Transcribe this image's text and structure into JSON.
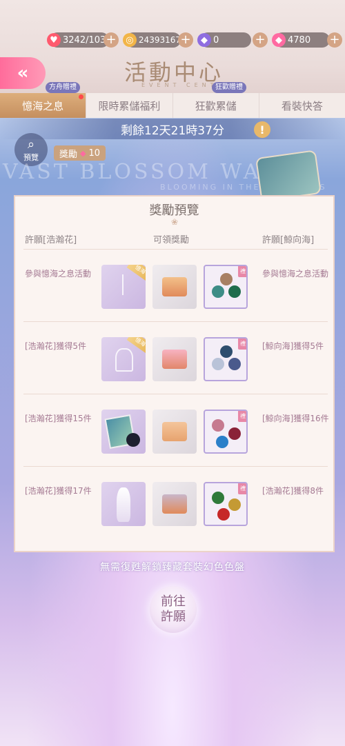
{
  "resources": [
    {
      "icon": "heart-icon",
      "value": "3242/103",
      "color": "#ff5a6e"
    },
    {
      "icon": "coin-icon",
      "value": "24393167",
      "color": "#f2b548"
    },
    {
      "icon": "purple-gem-icon",
      "value": "0",
      "color": "#8f6de0"
    },
    {
      "icon": "pink-gem-icon",
      "value": "4780",
      "color": "#ff6aa1"
    }
  ],
  "header": {
    "title": "活動中心",
    "subtitle": "EVENT CENTER"
  },
  "tabs": [
    {
      "label": "憶海之息",
      "tag": "方舟贈禮",
      "active": true
    },
    {
      "label": "限時累儲福利",
      "tag": "",
      "active": false
    },
    {
      "label": "狂歡累儲",
      "tag": "狂歡贈禮",
      "active": false
    },
    {
      "label": "看裝快答",
      "tag": "",
      "active": false
    }
  ],
  "timer": "剩餘12天21時37分",
  "preview_label": "預覽",
  "reward_chip": {
    "label": "獎勵",
    "count": "10"
  },
  "bg_text": {
    "main": "VAST BLOSSOM WAVES",
    "sub": "BLOOMING IN THE SKY WAVES"
  },
  "panel": {
    "title": "獎勵預覽",
    "headers": {
      "left": "許願[浩瀚花]",
      "center": "可領獎勵",
      "right": "許願[鯨向海]"
    },
    "rows": [
      {
        "left": "參與憶海之息活動",
        "right": "參與憶海之息活動",
        "corner": "憶海"
      },
      {
        "left": "[浩瀚花]獲得5件",
        "right": "[鯨向海]獲得5件",
        "corner": "憶海"
      },
      {
        "left": "[浩瀚花]獲得15件",
        "right": "[鯨向海]獲得16件",
        "corner": ""
      },
      {
        "left": "[浩瀚花]獲得17件",
        "right": "[浩瀚花]獲得8件",
        "corner": ""
      }
    ],
    "gift_label": "禮"
  },
  "bottom_text": "無需復甦解鎖臻藏套裝幻色色盤",
  "go_button": {
    "line1": "前往",
    "line2": "許願"
  }
}
